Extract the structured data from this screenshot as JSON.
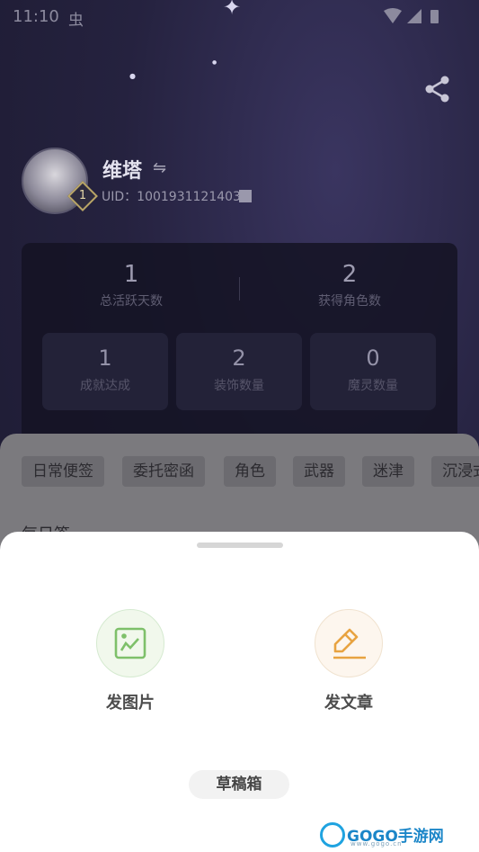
{
  "status_bar": {
    "time": "11:10",
    "app_icon": "bug-icon"
  },
  "profile": {
    "name": "维塔",
    "level": "1",
    "uid_label": "UID：",
    "uid": "1001931121403"
  },
  "stats": {
    "active_days": {
      "value": "1",
      "label": "总活跃天数"
    },
    "characters": {
      "value": "2",
      "label": "获得角色数"
    },
    "cards": [
      {
        "value": "1",
        "label": "成就达成"
      },
      {
        "value": "2",
        "label": "装饰数量"
      },
      {
        "value": "0",
        "label": "魔灵数量"
      }
    ]
  },
  "tabs": [
    "日常便签",
    "委托密函",
    "角色",
    "武器",
    "迷津",
    "沉浸式"
  ],
  "peek_text": "每日签",
  "sheet": {
    "options": [
      {
        "label": "发图片",
        "icon": "image-icon"
      },
      {
        "label": "发文章",
        "icon": "pen-icon"
      }
    ],
    "draft_label": "草稿箱"
  },
  "watermark": {
    "brand": "GOGO手游网",
    "url": "www.gogo.cn"
  },
  "colors": {
    "accent_green": "#7ec06a",
    "accent_orange": "#e8a341"
  }
}
